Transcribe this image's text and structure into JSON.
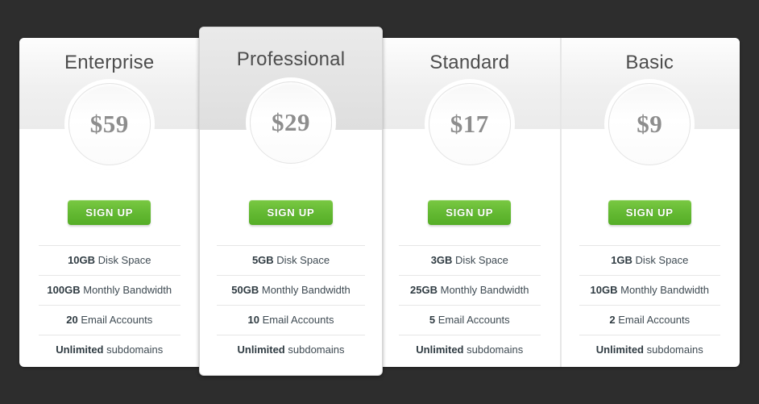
{
  "theme": {
    "page_background": "#2d2d2d",
    "card_background": "#ffffff",
    "accent_green": "#63b932",
    "title_color": "#4d4d4d",
    "price_color": "#8d8d8d",
    "divider_color": "#e6e6e6"
  },
  "plans": [
    {
      "name": "Enterprise",
      "price": "$59",
      "cta": "SIGN UP",
      "featured": false,
      "features": [
        {
          "value": "10GB",
          "label": "Disk Space"
        },
        {
          "value": "100GB",
          "label": "Monthly Bandwidth"
        },
        {
          "value": "20",
          "label": "Email Accounts"
        },
        {
          "value": "Unlimited",
          "label": "subdomains"
        }
      ]
    },
    {
      "name": "Professional",
      "price": "$29",
      "cta": "SIGN UP",
      "featured": true,
      "features": [
        {
          "value": "5GB",
          "label": "Disk Space"
        },
        {
          "value": "50GB",
          "label": "Monthly Bandwidth"
        },
        {
          "value": "10",
          "label": "Email Accounts"
        },
        {
          "value": "Unlimited",
          "label": "subdomains"
        }
      ]
    },
    {
      "name": "Standard",
      "price": "$17",
      "cta": "SIGN UP",
      "featured": false,
      "features": [
        {
          "value": "3GB",
          "label": "Disk Space"
        },
        {
          "value": "25GB",
          "label": "Monthly Bandwidth"
        },
        {
          "value": "5",
          "label": "Email Accounts"
        },
        {
          "value": "Unlimited",
          "label": "subdomains"
        }
      ]
    },
    {
      "name": "Basic",
      "price": "$9",
      "cta": "SIGN UP",
      "featured": false,
      "features": [
        {
          "value": "1GB",
          "label": "Disk Space"
        },
        {
          "value": "10GB",
          "label": "Monthly Bandwidth"
        },
        {
          "value": "2",
          "label": "Email Accounts"
        },
        {
          "value": "Unlimited",
          "label": "subdomains"
        }
      ]
    }
  ]
}
